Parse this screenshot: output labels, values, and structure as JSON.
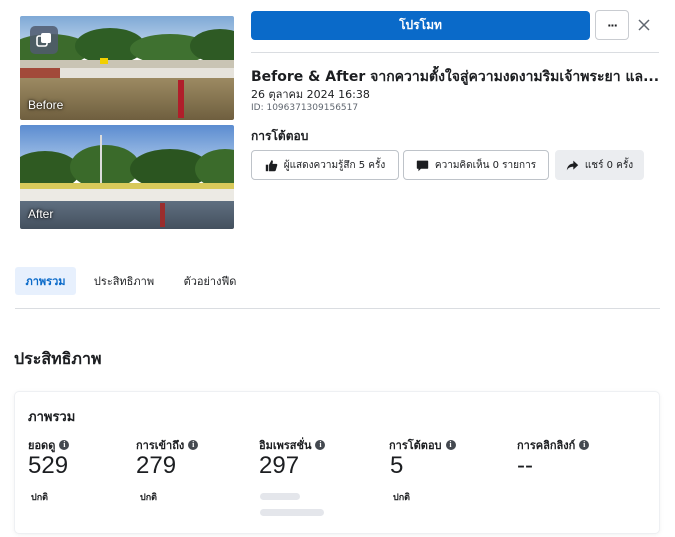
{
  "thumbnails": [
    {
      "label": "Before"
    },
    {
      "label": "After"
    }
  ],
  "header": {
    "promote_label": "โปรโมท",
    "more_label": "···",
    "close_label": "×"
  },
  "post": {
    "title": "Before & After จากความตั้งใจสู่ความงดงามริมเจ้าพระยา แล...",
    "date": "26 ตุลาคม 2024 16:38",
    "id": "ID: 1096371309156517"
  },
  "reactions": {
    "heading": "การโต้ตอบ",
    "reactions_label": "ผู้แสดงความรู้สึก 5 ครั้ง",
    "comments_label": "ความคิดเห็น 0 รายการ",
    "shares_label": "แชร์ 0 ครั้ง"
  },
  "tabs": [
    {
      "label": "ภาพรวม",
      "active": true
    },
    {
      "label": "ประสิทธิภาพ",
      "active": false
    },
    {
      "label": "ตัวอย่างฟีด",
      "active": false
    }
  ],
  "performance": {
    "section_title": "ประสิทธิภาพ",
    "card_title": "ภาพรวม",
    "metrics": [
      {
        "label": "ยอดดู",
        "value": "529",
        "sub": "ปกติ"
      },
      {
        "label": "การเข้าถึง",
        "value": "279",
        "sub": "ปกติ"
      },
      {
        "label": "อิมเพรสชั่น",
        "value": "297",
        "sub": ""
      },
      {
        "label": "การโต้ตอบ",
        "value": "5",
        "sub": "ปกติ"
      },
      {
        "label": "การคลิกลิงก์",
        "value": "--",
        "sub": ""
      }
    ]
  },
  "colors": {
    "accent": "#0a6ac9",
    "active_tab_bg": "#e7f0fd"
  },
  "icons": {
    "gallery": "gallery-icon",
    "like": "thumbs-up-icon",
    "comment": "comment-bubble-icon",
    "share": "share-arrow-icon",
    "info": "info-icon"
  }
}
